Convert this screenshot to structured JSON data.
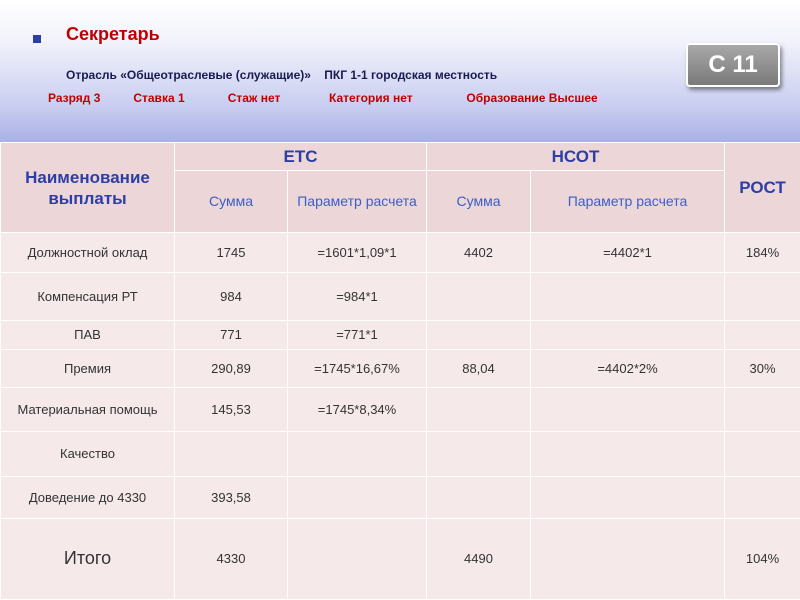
{
  "header": {
    "title": "Секретарь",
    "subtitle": "Отрасль «Общеотраслевые (служащие)»    ПКГ 1-1 городская местность",
    "params": [
      "Разряд 3",
      "Ставка 1",
      "Стаж  нет",
      "Категория нет",
      "Образование  Высшее"
    ],
    "code": "С 11"
  },
  "table": {
    "col_name": "Наименование выплаты",
    "group_etc": "ЕТС",
    "group_nsot": "НСОТ",
    "col_growth": "РОСТ",
    "sub_sum": "Сумма",
    "sub_param": "Параметр расчета",
    "rows": [
      {
        "label": "Должностной оклад",
        "etc_sum": "1745",
        "etc_param": "=1601*1,09*1",
        "nsot_sum": "4402",
        "nsot_param": "=4402*1",
        "growth": "184%"
      },
      {
        "label": "Компенсация РТ",
        "etc_sum": "984",
        "etc_param": "=984*1",
        "nsot_sum": "",
        "nsot_param": "",
        "growth": ""
      },
      {
        "label": "ПАВ",
        "etc_sum": "771",
        "etc_param": "=771*1",
        "nsot_sum": "",
        "nsot_param": "",
        "growth": ""
      },
      {
        "label": "Премия",
        "etc_sum": "290,89",
        "etc_param": "=1745*16,67%",
        "nsot_sum": "88,04",
        "nsot_param": "=4402*2%",
        "growth": "30%"
      },
      {
        "label": "Материальная помощь",
        "etc_sum": "145,53",
        "etc_param": "=1745*8,34%",
        "nsot_sum": "",
        "nsot_param": "",
        "growth": ""
      },
      {
        "label": "Качество",
        "etc_sum": "",
        "etc_param": "",
        "nsot_sum": "",
        "nsot_param": "",
        "growth": ""
      },
      {
        "label": "Доведение до 4330",
        "etc_sum": "393,58",
        "etc_param": "",
        "nsot_sum": "",
        "nsot_param": "",
        "growth": ""
      }
    ],
    "total": {
      "label": "Итого",
      "etc_sum": "4330",
      "etc_param": "",
      "nsot_sum": "4490",
      "nsot_param": "",
      "growth": "104%"
    }
  },
  "colors": {
    "accent_red": "#c00000",
    "accent_blue": "#2c3fa8",
    "table_bg": "#f6e9ea"
  }
}
